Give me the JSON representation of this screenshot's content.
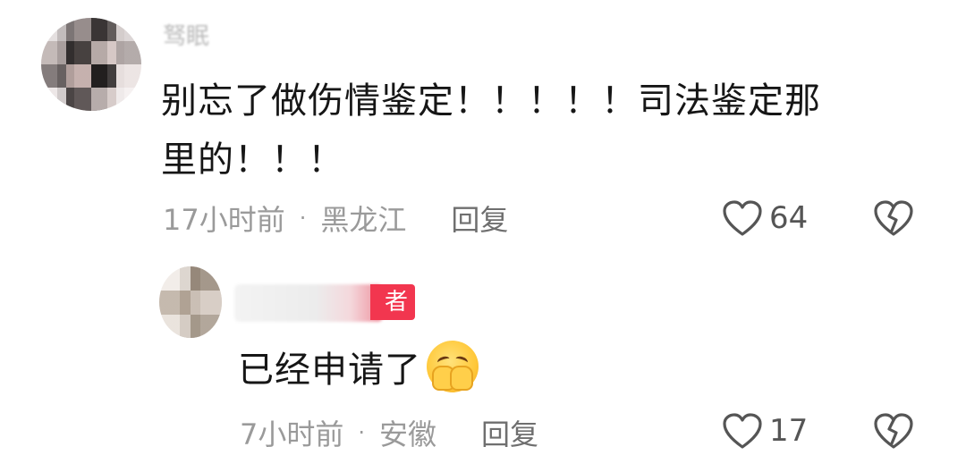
{
  "comments": [
    {
      "username": "驽眠",
      "text_line1": "别忘了做伤情鉴定！！！！！司法鉴定那",
      "text_line2": "里的！！！",
      "time": "17小时前",
      "separator": "·",
      "location": "黑龙江",
      "reply_label": "回复",
      "like_count": "64",
      "like_icon": "heart-outline-icon",
      "dislike_icon": "broken-heart-icon"
    },
    {
      "username": "",
      "badge": "者",
      "badge_color": "#f2364f",
      "text": "已经申请了",
      "emoji": "pleading-hands-face-emoji",
      "time": "7小时前",
      "separator": "·",
      "location": "安徽",
      "reply_label": "回复",
      "like_count": "17",
      "like_icon": "heart-outline-icon",
      "dislike_icon": "broken-heart-icon"
    }
  ]
}
